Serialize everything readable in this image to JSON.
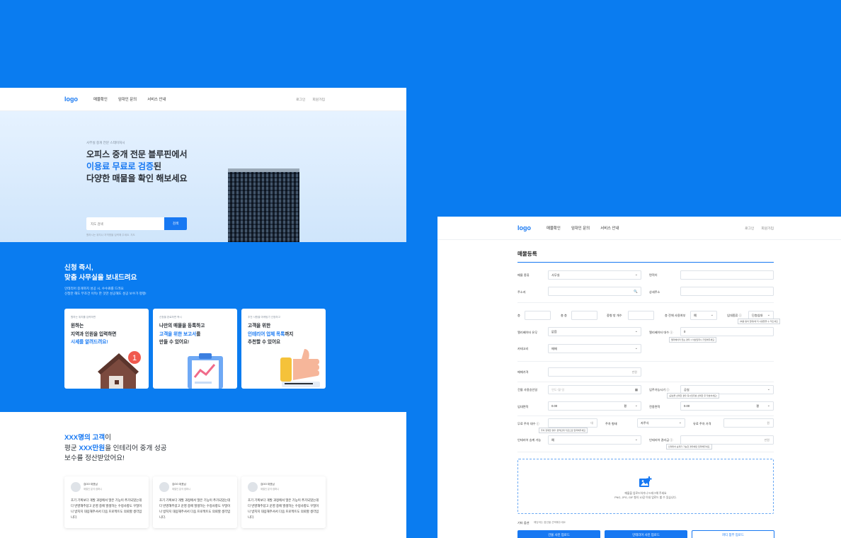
{
  "left": {
    "header": {
      "logo": "logo",
      "nav": [
        "매물확인",
        "임대인 문의",
        "서비스 안내"
      ],
      "login": "로그인",
      "signup": "회원가입"
    },
    "hero": {
      "sub": "사무실 중개 전문 스테이처시",
      "title1": "오피스 중개 전문 블루핀에서",
      "title2_hl": "이용료 무료로 검증",
      "title2_rest": "된",
      "title3": "다양한 매물을 확인 해보세요",
      "search_placeholder": "지도 검색",
      "search_button": "검색",
      "hint": "원하시는 위치나 지역명을 입력해 주세요. 지도"
    },
    "promo": {
      "title1": "신청 즉시,",
      "title2": "맞춤 사무실을 보내드려요",
      "desc1": "인테리어 중개까지 성공 시, 수수료를 드려요",
      "desc2": "신청만 해도 무조건 이득! 한 것만 성공해도 성공 보수가 평평!",
      "cards": [
        {
          "sub": "원하는 위치를 입력하면",
          "l1": "원하는",
          "l2": "지역과 인원을 입력하면",
          "l3": "시세를 알려드려요!"
        },
        {
          "sub": "신청을 완료하면 즉시",
          "l1": "나만의 매물을 등록하고",
          "l2a": "고객을 위한 보고서",
          "l2b": "를",
          "l3": "만들 수 있어요!"
        },
        {
          "sub": "추천 사항을 마케팅가 선정하고",
          "l1": "고객을 위한",
          "l2a": "인테리어 업체 목록",
          "l2b": "까지",
          "l3": "추천할 수 있어요"
        }
      ]
    },
    "reviews": {
      "t1_hl": "XXX명의 고객",
      "t1_rest": "이",
      "t2_a": "평균 ",
      "t2_hl": "XXX만원",
      "t2_b": "을 인테리어 중개 성공",
      "t3": "보수를 정산받았어요!",
      "items": [
        {
          "name": "김OO 대표님",
          "role": "제철인 분석 컴퍼니",
          "text": "초기 기획보다 개발 과정에서 많은 기능이 추가되었는데 다 반영해주셨고 운영 중에 발생하는 수정사항도 꾸밀이나 방치지 대응해주셔서 다음 프로젝트도 의뢰할 생각입니다."
        },
        {
          "name": "김OO 대표님",
          "role": "제철인 분석 컴퍼니",
          "text": "초기 기획보다 개발 과정에서 많은 기능이 추가되었는데 다 반영해주셨고 운영 중에 발생하는 수정사항도 꾸밀이나 방치지 대응해주셔서 다음 프로젝트도 의뢰할 생각입니다."
        },
        {
          "name": "김OO 대표님",
          "role": "제철인 분석 컴퍼니",
          "text": "초기 기획보다 개발 과정에서 많은 기능이 추가되었는데 다 반영해주셨고 운영 중에 발생하는 수정사항도 꾸밀이나 방치지 대응해주셔서 다음 프로젝트도 의뢰할 생각입니다."
        }
      ]
    }
  },
  "right": {
    "header": {
      "logo": "logo",
      "nav": [
        "매물확인",
        "임대인 문의",
        "서비스 안내"
      ],
      "login": "로그인",
      "signup": "회원가입"
    },
    "title": "매물등록",
    "f": {
      "type_l": "매물 종류",
      "type_v": "사무실",
      "area_l": "면적이",
      "addr_l": "주소지",
      "detail_l": "상세주소",
      "floor_l": "층",
      "total_l": "총 층",
      "rooms_l": "중형 방 개수",
      "shared_l": "층 전체 사용여부",
      "shared_v": "예",
      "unit_l": "임대종류 ⓘ",
      "unit_v": "단층임대",
      "unit_tip": "(복층 등의 임대)에 지 시층들을 수 적으셔요",
      "elev_l": "엘리베이터 유무",
      "elev_v": "없음",
      "elevc_l": "엘리베이터 대수 ⓘ",
      "elevc_v": "0",
      "elevc_tip": "엘리베이터 있는 경우 1 이상입력시 가입해주세요",
      "cat_l": "카테고리",
      "cat_v": "매매",
      "price_l": "매매가격",
      "price_u": "만원",
      "date_l": "건물 사용승인일",
      "date_ph": "연도-월-일",
      "move_l": "입주가능시기 ⓘ",
      "move_v": "공실",
      "move_tip": "(공실을 선택한 경우 즉시입주를 선택한 후 작성하세요)",
      "rent_l": "임대면적",
      "rent_v": "0.00",
      "rent_u": "평",
      "excl_l": "전용면적",
      "excl_v": "0.00",
      "excl_u": "평",
      "park_l": "무료 주차 대수 ⓘ",
      "park_u": "대",
      "park_tip": "주차 장재한 경우, 면적단위 기준으로 입력해주세요",
      "ptype_l": "주차 형태",
      "ptype_v": "자주식",
      "pfee_l": "유료 주차 가격",
      "pfee_u": "원",
      "int_l": "인테리어 승계 가능",
      "int_v": "예",
      "intfee_l": "인테리어 권리금 ⓘ",
      "intfee_u": "만원",
      "intfee_tip": "인테리어 승계가 가능한 경우에만 입력해주세요",
      "up1": "매물을 업로드하거나 드래그해 주세요",
      "up2": "PNG, JPG, GIF 형식 10장 이내 업로드 할 수 있습니다.",
      "etc_l": "기타 옵션",
      "etc_v": "해당하는 옵션을 선택해주세요",
      "b1": "건물 사진 업로드",
      "b2": "인테리어 사진 업로드",
      "b3": "파티 첨부 업로드"
    }
  },
  "colors": {
    "primary": "#1778f2",
    "bg": "#0a7cf0"
  }
}
